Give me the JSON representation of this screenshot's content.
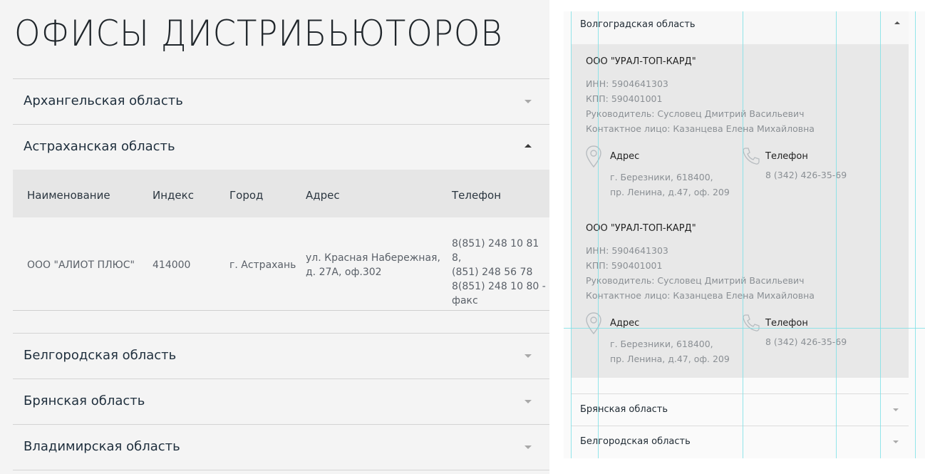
{
  "page_title": "ОФИСЫ ДИСТРИБЬЮТОРОВ",
  "regions_left": {
    "arkhangelsk": "Архангельская область",
    "astrakhan": "Астраханская область",
    "belgorod": "Белгородская область",
    "bryansk": "Брянская область",
    "vladimir": "Владимирская область"
  },
  "table": {
    "headers": [
      "Наименование",
      "Индекс",
      "Город",
      "Адрес",
      "Телефон"
    ],
    "row": {
      "name": "ООО \"АЛИОТ ПЛЮС\"",
      "index": "414000",
      "city": "г. Астрахань",
      "address_1": "ул. Красная Набережная,",
      "address_2": "д. 27А, оф.302",
      "phone_1": "8(851) 248 10 81 8,",
      "phone_2": "(851) 248 56 78",
      "phone_3": "8(851) 248 10 80 -",
      "phone_4": "факс"
    }
  },
  "right_panel": {
    "open_region": "Волгоградская область",
    "cards": [
      {
        "name": "ООО \"УРАЛ-ТОП-КАРД\"",
        "inn": "ИНН: 5904641303",
        "kpp": "КПП: 590401001",
        "director": "Руководитель: Сусловец Дмитрий Васильевич",
        "contact": "Контактное лицо: Казанцева Елена Михайловна",
        "address_label": "Адрес",
        "address_1": "г. Березники, 618400,",
        "address_2": "пр. Ленина, д.47, оф. 209",
        "phone_label": "Телефон",
        "phone": "8 (342) 426-35-69"
      },
      {
        "name": "ООО \"УРАЛ-ТОП-КАРД\"",
        "inn": "ИНН: 5904641303",
        "kpp": "КПП: 590401001",
        "director": "Руководитель: Сусловец Дмитрий Васильевич",
        "contact": "Контактное лицо: Казанцева Елена Михайловна",
        "address_label": "Адрес",
        "address_1": "г. Березники, 618400,",
        "address_2": "пр. Ленина, д.47, оф. 209",
        "phone_label": "Телефон",
        "phone": "8 (342) 426-35-69"
      }
    ],
    "collapsed_regions": [
      "Брянская область",
      "Белгородская область"
    ]
  },
  "icons": [
    "caret-down-icon",
    "caret-up-icon",
    "map-pin-icon",
    "phone-icon"
  ],
  "colors": {
    "accent_guides": "#7fe0e6",
    "panel_bg": "#f4f4f4",
    "header_bg": "#e6e6e6"
  }
}
